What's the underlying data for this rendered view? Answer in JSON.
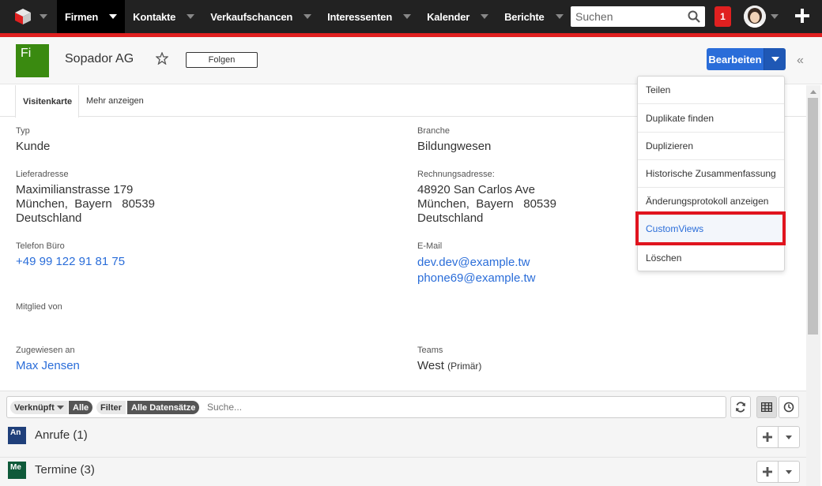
{
  "nav": {
    "items": [
      {
        "label": "Firmen",
        "active": true
      },
      {
        "label": "Kontakte"
      },
      {
        "label": "Verkaufschancen"
      },
      {
        "label": "Interessenten"
      },
      {
        "label": "Kalender"
      },
      {
        "label": "Berichte"
      }
    ],
    "search_placeholder": "Suchen",
    "notification_count": "1",
    "accent_color": "#e02020"
  },
  "header": {
    "badge": "Fi",
    "badge_color": "#3a8a10",
    "title": "Sopador AG",
    "follow_label": "Folgen",
    "edit_label": "Bearbeiten"
  },
  "tabs": {
    "active": "Visitenkarte",
    "more": "Mehr anzeigen"
  },
  "fields": {
    "type": {
      "label": "Typ",
      "value": "Kunde"
    },
    "industry": {
      "label": "Branche",
      "value": "Bildungwesen"
    },
    "shipping": {
      "label": "Lieferadresse",
      "street": "Maximilianstrasse 179",
      "city": "München,  Bayern   80539",
      "country": "Deutschland"
    },
    "billing": {
      "label": "Rechnungsadresse:",
      "street": "48920 San Carlos Ave",
      "city": "München,  Bayern   80539",
      "country": "Deutschland"
    },
    "phone": {
      "label": "Telefon Büro",
      "value": "+49 99 122 91 81 75"
    },
    "email": {
      "label": "E-Mail",
      "value1": "dev.dev@example.tw",
      "value2": "phone69@example.tw"
    },
    "member_of": {
      "label": "Mitglied von"
    },
    "assigned": {
      "label": "Zugewiesen an",
      "value": "Max Jensen"
    },
    "teams": {
      "label": "Teams",
      "value": "West",
      "primary": "(Primär)"
    }
  },
  "dropdown": {
    "items": [
      "Teilen",
      "Duplikate finden",
      "Duplizieren",
      "Historische Zusammenfassung",
      "Änderungsprotokoll anzeigen",
      "CustomViews",
      "Löschen"
    ]
  },
  "bottom": {
    "linked_label": "Verknüpft",
    "linked_value": "Alle",
    "filter_label": "Filter",
    "filter_value": "Alle Datensätze",
    "search_placeholder": "Suche...",
    "rows": [
      {
        "badge": "An",
        "title": "Anrufe (1)",
        "color": "#1f3f7a"
      },
      {
        "badge": "Me",
        "title": "Termine (3)",
        "color": "#0f5a3a"
      }
    ]
  }
}
